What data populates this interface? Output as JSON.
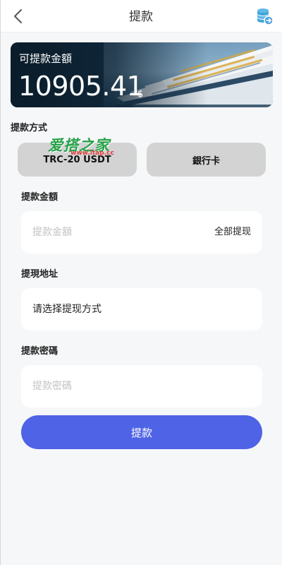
{
  "header": {
    "title": "提款",
    "back_icon": "chevron-left-icon",
    "right_icon": "coin-stack-icon"
  },
  "balance": {
    "label": "可提款金額",
    "amount": "10905.41",
    "unit": "$"
  },
  "method": {
    "title": "提款方式",
    "options": [
      "TRC-20 USDT",
      "銀行卡"
    ]
  },
  "watermark": {
    "text": "爱搭之家",
    "url": "www.itap.cc"
  },
  "amount_field": {
    "title": "提款金額",
    "placeholder": "提款金額",
    "all_label": "全部提现"
  },
  "address_field": {
    "title": "提現地址",
    "value": "请选择提现方式"
  },
  "password_field": {
    "title": "提款密碼",
    "placeholder": "提款密碼"
  },
  "submit": {
    "label": "提款"
  },
  "colors": {
    "primary": "#4f63e6",
    "option_bg": "#d3d3d3",
    "page_bg": "#f6f7f9"
  }
}
